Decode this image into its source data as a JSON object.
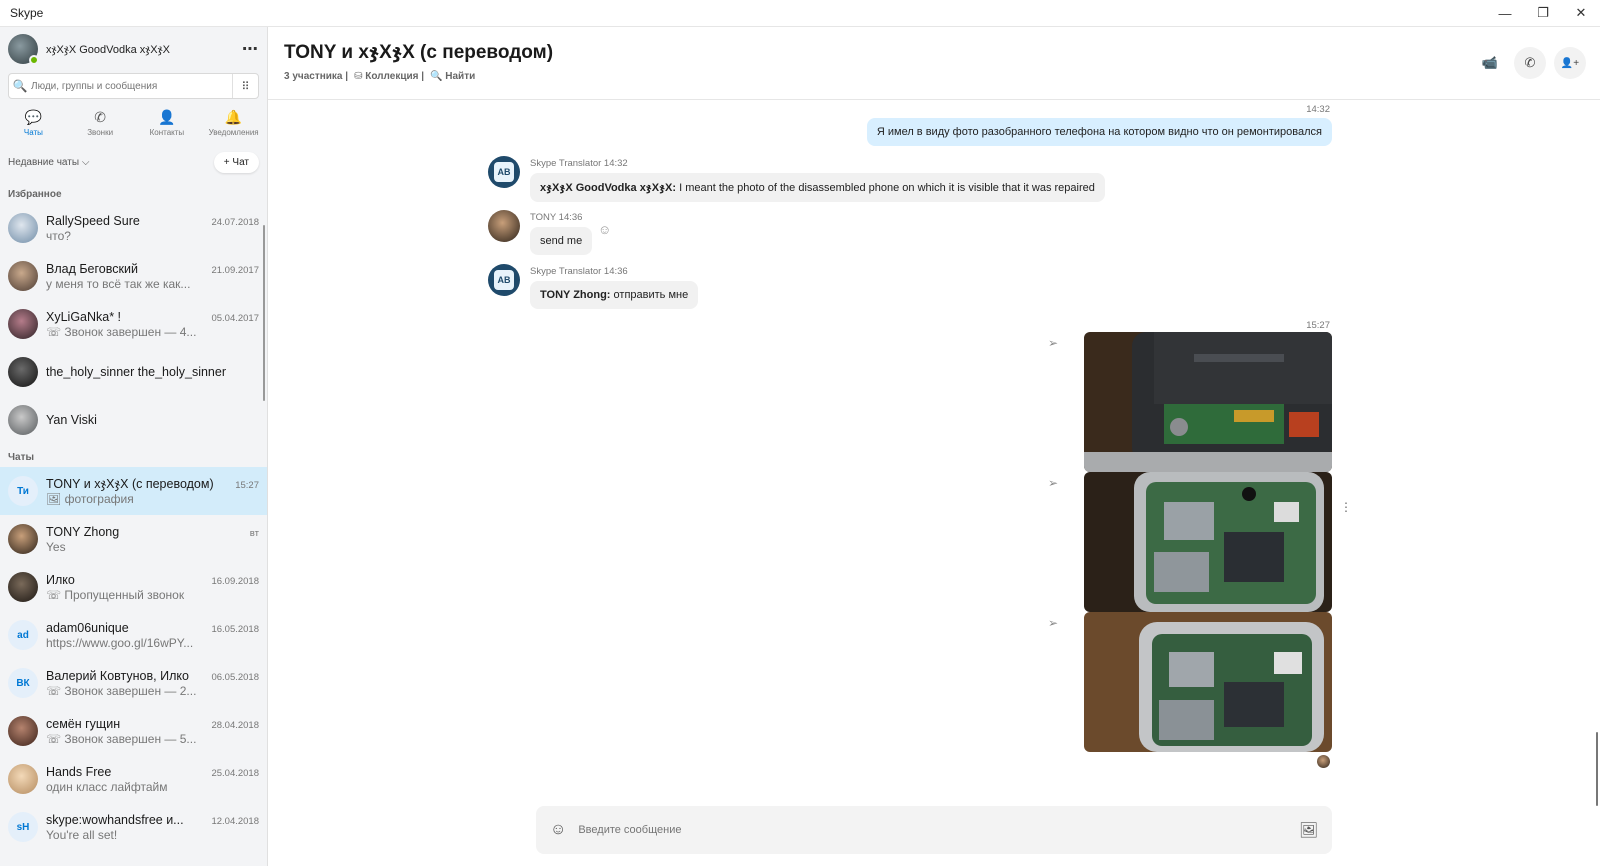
{
  "window": {
    "title": "Skype",
    "controls": [
      "—",
      "❐",
      "✕"
    ]
  },
  "profile": {
    "name": "xჯXჯX GoodVodka xჯXჯX",
    "more_icon": "⋯"
  },
  "search": {
    "placeholder": "Люди, группы и сообщения",
    "icon": "🔍",
    "dialpad_icon": "⠿"
  },
  "nav": {
    "tabs": [
      {
        "label": "Чаты",
        "icon": "💬"
      },
      {
        "label": "Звонки",
        "icon": "✆"
      },
      {
        "label": "Контакты",
        "icon": "👤"
      },
      {
        "label": "Уведомления",
        "icon": "🔔"
      }
    ]
  },
  "recent": {
    "label": "Недавние чаты ⌵",
    "new_chat": "+ Чат"
  },
  "favorites": {
    "label": "Избранное",
    "items": [
      {
        "name": "RallySpeed Sure",
        "date": "24.07.2018",
        "preview": "что?"
      },
      {
        "name": "Влад Беговский",
        "date": "21.09.2017",
        "preview": "у меня то всё так же как..."
      },
      {
        "name": "XyLiGaNka* !",
        "date": "05.04.2017",
        "preview": "☏ Звонок завершен — 4..."
      },
      {
        "name": "the_holy_sinner the_holy_sinner",
        "date": "",
        "preview": ""
      },
      {
        "name": "Yan Viski",
        "date": "",
        "preview": ""
      }
    ]
  },
  "chats": {
    "label": "Чаты",
    "items": [
      {
        "name": "TONY и xჯXჯX (с переводом)",
        "date": "15:27",
        "preview": "🖼 фотография",
        "initials": "Ти"
      },
      {
        "name": "TONY Zhong",
        "date": "вт",
        "preview": "Yes",
        "initials": ""
      },
      {
        "name": "Илко",
        "date": "16.09.2018",
        "preview": "☏ Пропущенный звонок",
        "initials": ""
      },
      {
        "name": "adam06unique",
        "date": "16.05.2018",
        "preview": "https://www.goo.gl/16wPY...",
        "initials": "ad"
      },
      {
        "name": "Валерий Ковтунов, Илко",
        "date": "06.05.2018",
        "preview": "☏ Звонок завершен — 2...",
        "initials": "ВК"
      },
      {
        "name": "семён гущин",
        "date": "28.04.2018",
        "preview": "☏ Звонок завершен — 5...",
        "initials": ""
      },
      {
        "name": "Hands Free",
        "date": "25.04.2018",
        "preview": "один класс лайфтайм",
        "initials": ""
      },
      {
        "name": "skype:wowhandsfree и...",
        "date": "12.04.2018",
        "preview": "You're all set!",
        "initials": "sH"
      }
    ]
  },
  "conversation": {
    "title": "TONY и xჯXჯX (с переводом)",
    "participants": "3 участника |",
    "collection": "⛁ Коллекция |",
    "find": "🔍 Найти",
    "icons": {
      "video": "📹",
      "call": "✆",
      "add_person": "👤+"
    }
  },
  "messages": {
    "ts1": "14:32",
    "out1": "Я имел в виду фото разобранного телефона на котором видно что он ремонтировался",
    "sender1": "Skype Translator 14:32",
    "in1_name": "xჯXჯX GoodVodka xჯXჯX:",
    "in1_text": " I meant the photo of the disassembled phone on which it is visible that it was repaired",
    "sender2": "TONY 14:36",
    "in2_text": "send me",
    "sender3": "Skype Translator 14:36",
    "in3_name": "TONY Zhong:",
    "in3_text": " отправить мне",
    "ts2": "15:27",
    "more_icon": "⋮",
    "react_icon": "☺",
    "send_icon": "➢"
  },
  "composer": {
    "placeholder": "Введите сообщение",
    "emoji_icon": "☺",
    "media_icon": "🖼"
  }
}
